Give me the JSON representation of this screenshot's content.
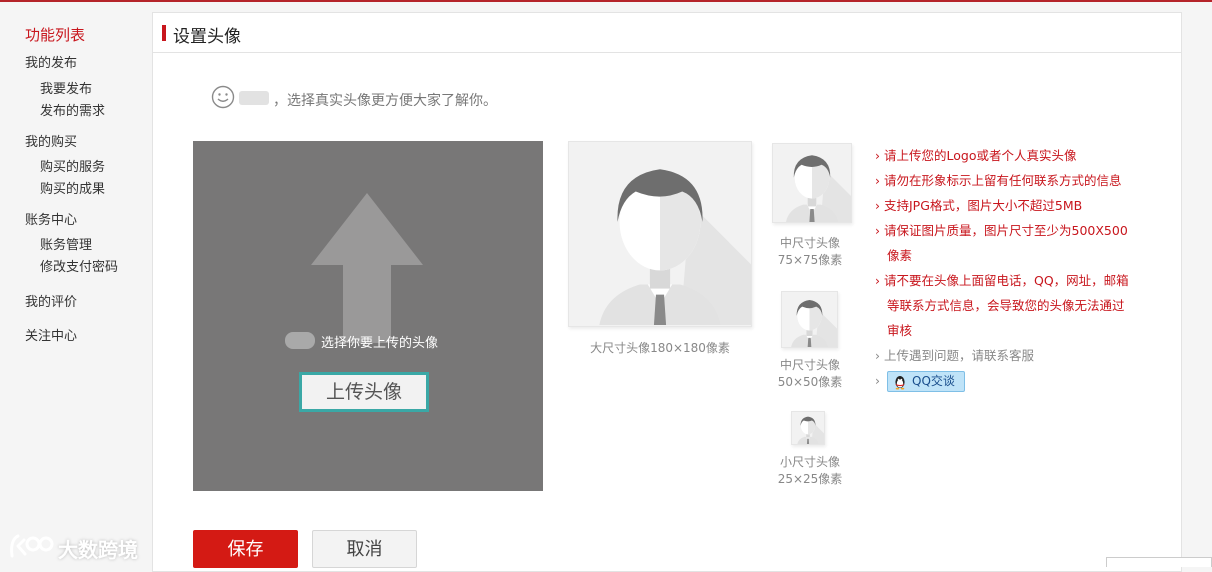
{
  "sidebar": {
    "title": "功能列表",
    "groups": [
      {
        "label": "我的发布",
        "items": [
          "我要发布",
          "发布的需求"
        ]
      },
      {
        "label": "我的购买",
        "items": [
          "购买的服务",
          "购买的成果"
        ]
      },
      {
        "label": "账务中心",
        "items": [
          "账务管理",
          "修改支付密码"
        ]
      },
      {
        "label": "我的评价",
        "items": []
      },
      {
        "label": "关注中心",
        "items": []
      }
    ]
  },
  "panel": {
    "title": "设置头像",
    "hint": "，选择真实头像更方便大家了解你。"
  },
  "upload": {
    "choose_text": "选择你要上传的头像",
    "button_label": "上传头像"
  },
  "previews": {
    "large": {
      "label": "大尺寸头像180×180像素"
    },
    "medium75": {
      "label1": "中尺寸头像",
      "label2": "75×75像素"
    },
    "medium50": {
      "label1": "中尺寸头像",
      "label2": "50×50像素"
    },
    "small25": {
      "label1": "小尺寸头像",
      "label2": "25×25像素"
    }
  },
  "rules": {
    "items": [
      "请上传您的Logo或者个人真实头像",
      "请勿在形象标示上留有任何联系方式的信息",
      "支持JPG格式，图片大小不超过5MB",
      "请保证图片质量，图片尺寸至少为500X500",
      "像素",
      "请不要在头像上面留电话，QQ，网址，邮箱",
      "等联系方式信息，会导致您的头像无法通过",
      "审核",
      "上传遇到问题，请联系客服"
    ],
    "qq_label": "QQ交谈"
  },
  "actions": {
    "save_label": "保存",
    "cancel_label": "取消"
  },
  "watermark": {
    "text": "大数跨境"
  },
  "colors": {
    "accent": "#c8161d",
    "upload_bg": "#787777",
    "upload_border": "#3aa8a6",
    "save_bg": "#d41a14"
  }
}
